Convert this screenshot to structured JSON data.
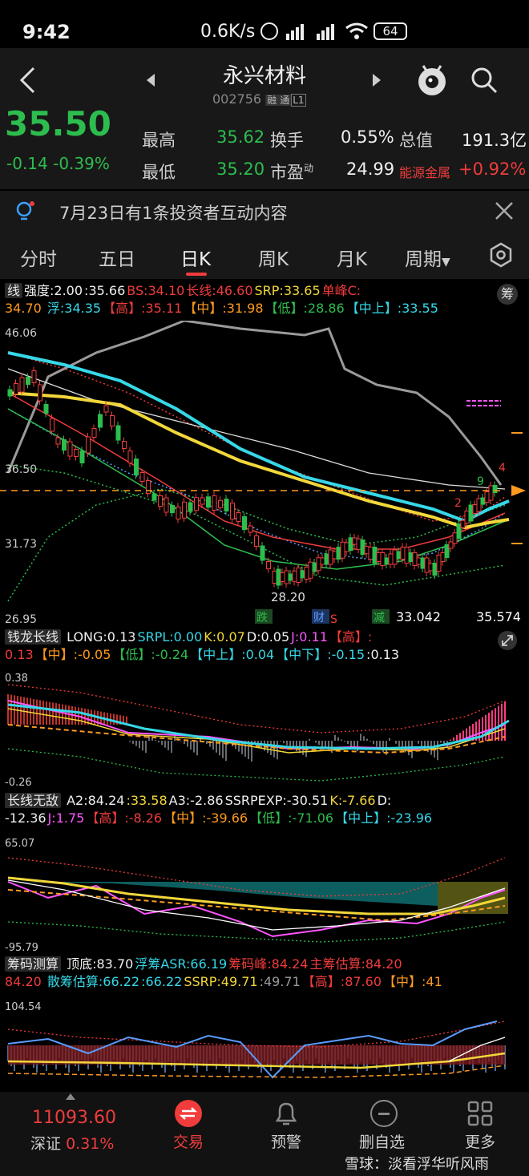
{
  "status_bar": {
    "time": "9:42",
    "net_speed": "0.6K/s",
    "battery": "64"
  },
  "header": {
    "title": "永兴材料",
    "code": "002756",
    "badge1": "融",
    "badge2": "通",
    "badge3": "L1"
  },
  "quote": {
    "price": "35.50",
    "change": "-0.14",
    "change_pct": "-0.39%",
    "high_label": "最高",
    "high": "35.62",
    "turnover_label": "换手",
    "turnover": "0.55%",
    "mktcap_label": "总值",
    "mktcap": "191.3亿",
    "low_label": "最低",
    "low": "35.20",
    "pe_label": "市盈",
    "pe_sup": "动",
    "pe": "24.99",
    "sector": "能源金属",
    "sector_change": "+0.92%"
  },
  "notice": {
    "text": "7月23日有1条投资者互动内容"
  },
  "tabs": {
    "t1": "分时",
    "t2": "五日",
    "t3": "日K",
    "t4": "周K",
    "t5": "月K",
    "t6": "周期"
  },
  "main": {
    "name": "线",
    "p1": "强度:2.00",
    "p2": ":35.66",
    "p3": "BS:34.10",
    "p4": "长线:46.60",
    "p5": "SRP:33.65",
    "p6": "单峰C:",
    "q1": "34.70",
    "q2": "浮:34.35",
    "q3": "【高】:35.11",
    "q4": "【中】:31.98",
    "q5": "【低】:28.86",
    "q6": "【中上】:33.55",
    "chip": "筹",
    "y_top": "46.06",
    "y_mid1": "36.50",
    "y_mid2": "31.73",
    "y_bot": "26.95",
    "low_label": "28.20",
    "m1": "跌",
    "m2": "财",
    "m3": "S",
    "m4": "减",
    "x_left": "33.042",
    "x_right": "35.574",
    "n9": "9",
    "n2": "2",
    "n4": "4"
  },
  "ind1": {
    "name": "钱龙长线",
    "a": "LONG:0.13",
    "b": "SRPL:0.00",
    "c": "K:0.07",
    "d": "D:0.05",
    "e": "J:0.11",
    "f": "【高】:",
    "g": "0.13",
    "h": "【中】:-0.05",
    "i": "【低】:-0.24",
    "j": "【中上】:0.04",
    "k": "【中下】:-0.15",
    "l": ":0.13",
    "y_top": "0.38",
    "y_bot": "-0.26"
  },
  "ind2": {
    "name": "长线无敌",
    "a": "A2:84.24",
    "b": ":33.58",
    "c": "A3:-2.86",
    "d": "SSRPEXP:-30.51",
    "e": "K:-7.66",
    "f": "D:",
    "g": "-12.36",
    "h": "J:1.75",
    "i": "【高】:-8.26",
    "j": "【中】:-39.66",
    "k": "【低】:-71.06",
    "l": "【中上】:-23.96",
    "y_top": "65.07",
    "y_bot": "-95.79"
  },
  "ind3": {
    "name": "筹码测算",
    "a": "顶底:83.70",
    "b": "浮筹ASR:66.19",
    "c": "筹码峰:84.24",
    "d": "主筹估算:84.20",
    "g": "84.20",
    "h": "散筹估算:66.22",
    "i": ":66.22",
    "j": "SSRP:49.71",
    "k": ":49.71",
    "l": "【高】:87.60",
    "m": "【中】:41",
    "y_top": "104.54"
  },
  "bottom": {
    "index_value": "11093.60",
    "index_name": "深证",
    "index_pct": "0.31%",
    "tab1": "交易",
    "tab2": "预警",
    "tab3": "删自选",
    "tab4": "更多",
    "watermark": "雪球：淡看浮华听风雨"
  },
  "colors": {
    "red": "#f03c3c",
    "green": "#2dbd4e",
    "yellow": "#f2d73a",
    "cyan": "#36d8e8"
  }
}
